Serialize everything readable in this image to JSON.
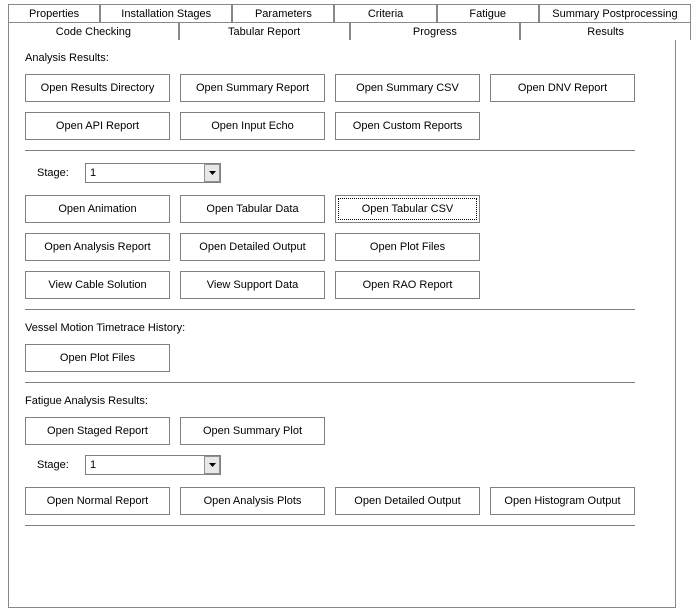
{
  "tabs_row1": {
    "properties": "Properties",
    "installation_stages": "Installation Stages",
    "parameters": "Parameters",
    "criteria": "Criteria",
    "fatigue": "Fatigue",
    "summary_postprocessing": "Summary Postprocessing"
  },
  "tabs_row2": {
    "code_checking": "Code Checking",
    "tabular_report": "Tabular Report",
    "progress": "Progress",
    "results": "Results"
  },
  "analysis": {
    "heading": "Analysis Results:",
    "open_results_directory": "Open Results Directory",
    "open_summary_report": "Open Summary Report",
    "open_summary_csv": "Open Summary CSV",
    "open_dnv_report": "Open DNV Report",
    "open_api_report": "Open API Report",
    "open_input_echo": "Open Input Echo",
    "open_custom_reports": "Open Custom Reports",
    "stage_label": "Stage:",
    "stage_value": "1",
    "open_animation": "Open Animation",
    "open_tabular_data": "Open Tabular Data",
    "open_tabular_csv": "Open Tabular CSV",
    "open_analysis_report": "Open Analysis Report",
    "open_detailed_output": "Open Detailed Output",
    "open_plot_files": "Open Plot Files",
    "view_cable_solution": "View Cable Solution",
    "view_support_data": "View Support Data",
    "open_rao_report": "Open RAO Report"
  },
  "vessel_motion": {
    "heading": "Vessel Motion Timetrace History:",
    "open_plot_files": "Open Plot Files"
  },
  "fatigue_analysis": {
    "heading": "Fatigue Analysis Results:",
    "open_staged_report": "Open Staged Report",
    "open_summary_plot": "Open Summary Plot",
    "stage_label": "Stage:",
    "stage_value": "1",
    "open_normal_report": "Open Normal Report",
    "open_analysis_plots": "Open Analysis Plots",
    "open_detailed_output": "Open Detailed Output",
    "open_histogram_output": "Open Histogram Output"
  }
}
